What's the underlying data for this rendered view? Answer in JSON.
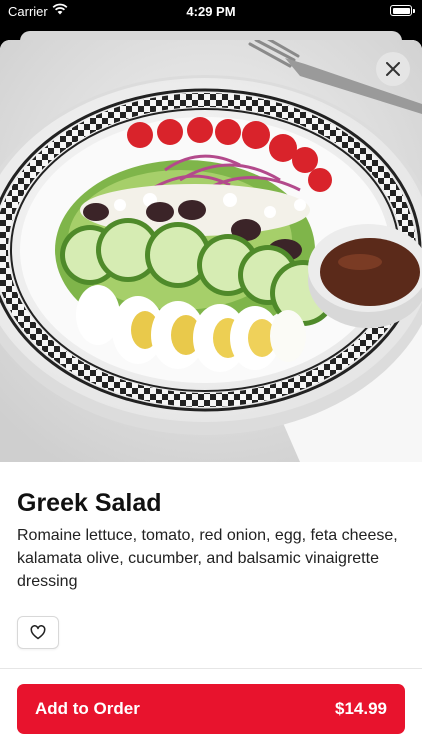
{
  "status_bar": {
    "carrier": "Carrier",
    "time": "4:29 PM"
  },
  "item": {
    "name": "Greek Salad",
    "description": "Romaine lettuce, tomato, red onion, egg, feta cheese, kalamata olive, cucumber, and balsamic vinaigrette dressing",
    "image_icon": "greek-salad-photo"
  },
  "controls": {
    "close_icon": "close-icon",
    "favorite_icon": "heart-icon"
  },
  "cta": {
    "label": "Add to Order",
    "price": "$14.99",
    "color": "#e8132d"
  }
}
